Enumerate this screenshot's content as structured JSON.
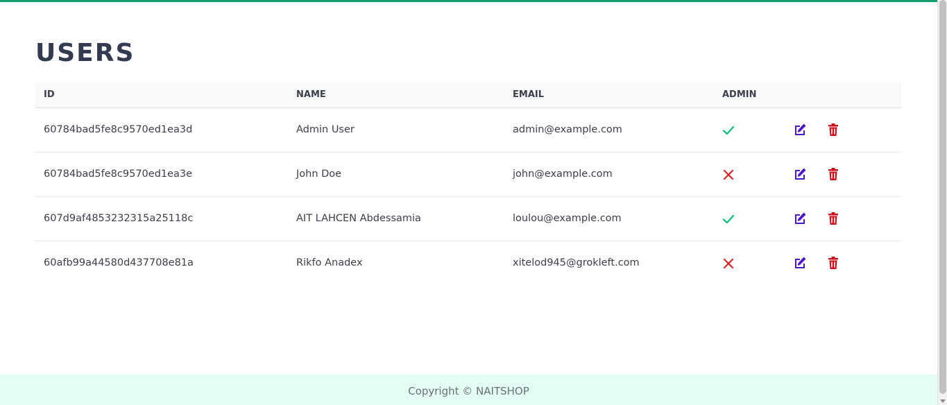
{
  "page": {
    "title": "USERS"
  },
  "table": {
    "headers": {
      "id": "ID",
      "name": "NAME",
      "email": "EMAIL",
      "admin": "ADMIN"
    },
    "rows": [
      {
        "id": "60784bad5fe8c9570ed1ea3d",
        "name": "Admin User",
        "email": "admin@example.com",
        "admin": true
      },
      {
        "id": "60784bad5fe8c9570ed1ea3e",
        "name": "John Doe",
        "email": "john@example.com",
        "admin": false
      },
      {
        "id": "607d9af4853232315a25118c",
        "name": "AIT LAHCEN Abdessamia",
        "email": "loulou@example.com",
        "admin": true
      },
      {
        "id": "60afb99a44580d437708e81a",
        "name": "Rikfo Anadex",
        "email": "xitelod945@grokleft.com",
        "admin": false
      }
    ]
  },
  "icons": {
    "admin_true": "check-icon",
    "admin_false": "x-icon",
    "edit": "edit-icon",
    "delete": "trash-icon"
  },
  "colors": {
    "accent_bar": "#0f9d6e",
    "check": "#13c07a",
    "cross": "#e02424",
    "edit": "#4b17c8",
    "delete": "#c8101e",
    "footer_bg": "#e3fdf2"
  },
  "footer": {
    "text": "Copyright © NAITSHOP"
  }
}
